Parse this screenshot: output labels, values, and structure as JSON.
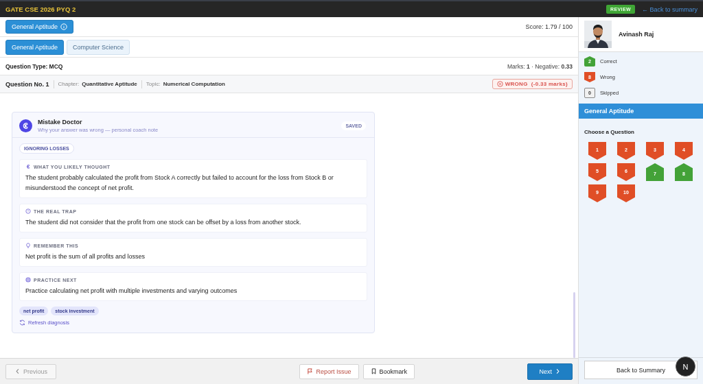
{
  "topbar": {
    "title": "GATE CSE 2026 PYQ 2",
    "badge": "REVIEW",
    "back_link": "← Back to summary"
  },
  "section_button": {
    "label": "General Aptitude"
  },
  "score": "Score: 1.79 / 100",
  "tabs": [
    {
      "label": "General Aptitude",
      "selected": true
    },
    {
      "label": "Computer Science",
      "selected": false
    }
  ],
  "question_type": "Question Type: MCQ",
  "marks": "Marks: **1** · Negative: **0.33**",
  "question": {
    "number": "Question No. 1",
    "chapter_label": "Chapter:",
    "chapter": "Quantitative Aptitude",
    "topic_label": "Topic:",
    "topic": "Numerical Computation",
    "result": "WRONG  (-0.33 marks)"
  },
  "mistake_doctor": {
    "title": "Mistake Doctor",
    "subtitle": "Why your answer was wrong — personal coach note",
    "status": "SAVED",
    "category": "IGNORING LOSSES",
    "sections": [
      {
        "kind": "thought",
        "heading": "WHAT YOU LIKELY THOUGHT",
        "text": "The student probably calculated the profit from Stock A correctly but failed to account for the loss from Stock B or misunderstood the concept of net profit."
      },
      {
        "kind": "trap",
        "heading": "THE REAL TRAP",
        "text": "The student did not consider that the profit from one stock can be offset by a loss from another stock."
      },
      {
        "kind": "remember",
        "heading": "REMEMBER THIS",
        "text": "Net profit is the sum of all profits and losses"
      },
      {
        "kind": "practice",
        "heading": "PRACTICE NEXT",
        "text": "Practice calculating net profit with multiple investments and varying outcomes"
      }
    ],
    "tags": [
      "net profit",
      "stock investment"
    ],
    "refresh": "Refresh diagnosis"
  },
  "footer": {
    "previous": "Previous",
    "report": "Report Issue",
    "bookmark": "Bookmark",
    "next": "Next"
  },
  "sidebar": {
    "user_name": "Avinash Raj",
    "legend": [
      {
        "kind": "correct",
        "count": "2",
        "label": "Correct"
      },
      {
        "kind": "wrong",
        "count": "8",
        "label": "Wrong"
      },
      {
        "kind": "skipped",
        "count": "0",
        "label": "Skipped"
      }
    ],
    "section_title": "General Aptitude",
    "palette_title": "Choose a Question",
    "questions": [
      {
        "number": "1",
        "kind": "wrong"
      },
      {
        "number": "2",
        "kind": "wrong"
      },
      {
        "number": "3",
        "kind": "wrong"
      },
      {
        "number": "4",
        "kind": "wrong"
      },
      {
        "number": "5",
        "kind": "wrong"
      },
      {
        "number": "6",
        "kind": "wrong"
      },
      {
        "number": "7",
        "kind": "correct"
      },
      {
        "number": "8",
        "kind": "correct"
      },
      {
        "number": "9",
        "kind": "wrong"
      },
      {
        "number": "10",
        "kind": "wrong"
      }
    ],
    "back_button": "Back to Summary"
  },
  "dev_badge": "N"
}
